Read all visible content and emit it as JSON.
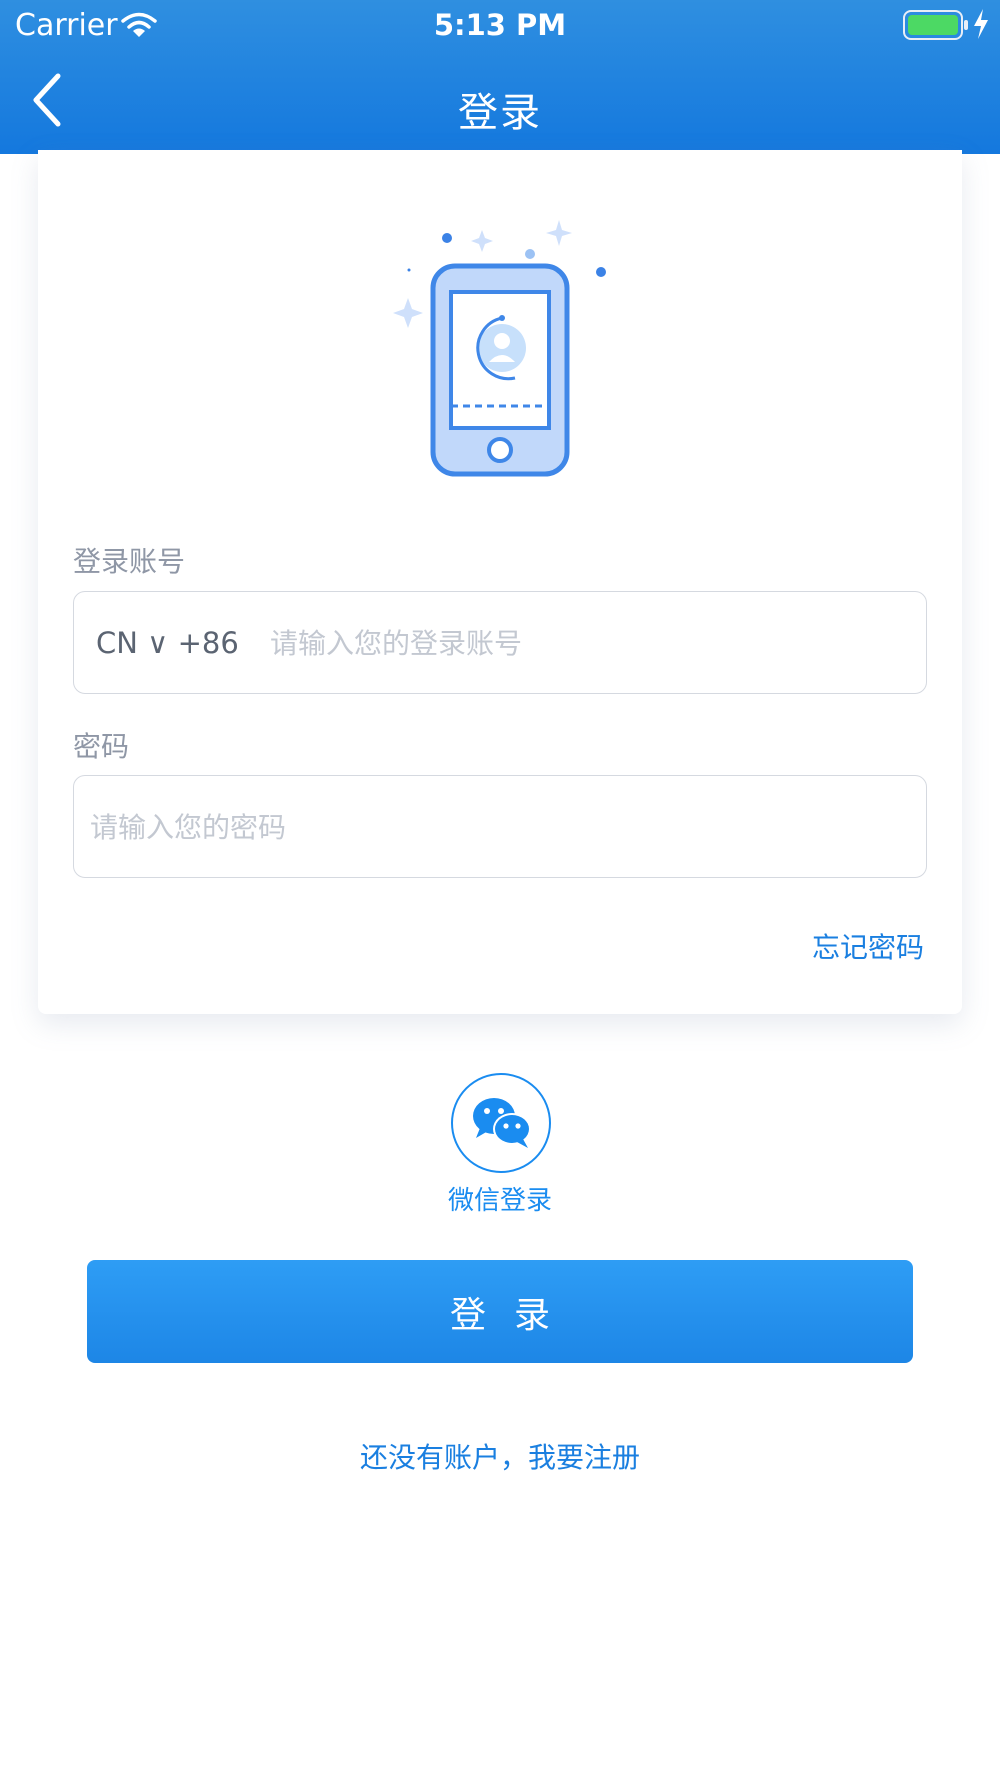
{
  "status_bar": {
    "carrier": "Carrier",
    "time": "5:13 PM"
  },
  "nav": {
    "title": "登录"
  },
  "form": {
    "account_label": "登录账号",
    "country_code": "CN ∨ +86",
    "account_placeholder": "请输入您的登录账号",
    "account_value": "",
    "password_label": "密码",
    "password_placeholder": "请输入您的密码",
    "password_value": "",
    "forgot_password": "忘记密码"
  },
  "wechat": {
    "label": "微信登录",
    "icon": "wechat-icon"
  },
  "actions": {
    "login_label": "登录",
    "register_link": "还没有账户，我要注册"
  },
  "colors": {
    "header": "#1d82de",
    "accent": "#1a8cf0",
    "battery": "#4cd964"
  }
}
